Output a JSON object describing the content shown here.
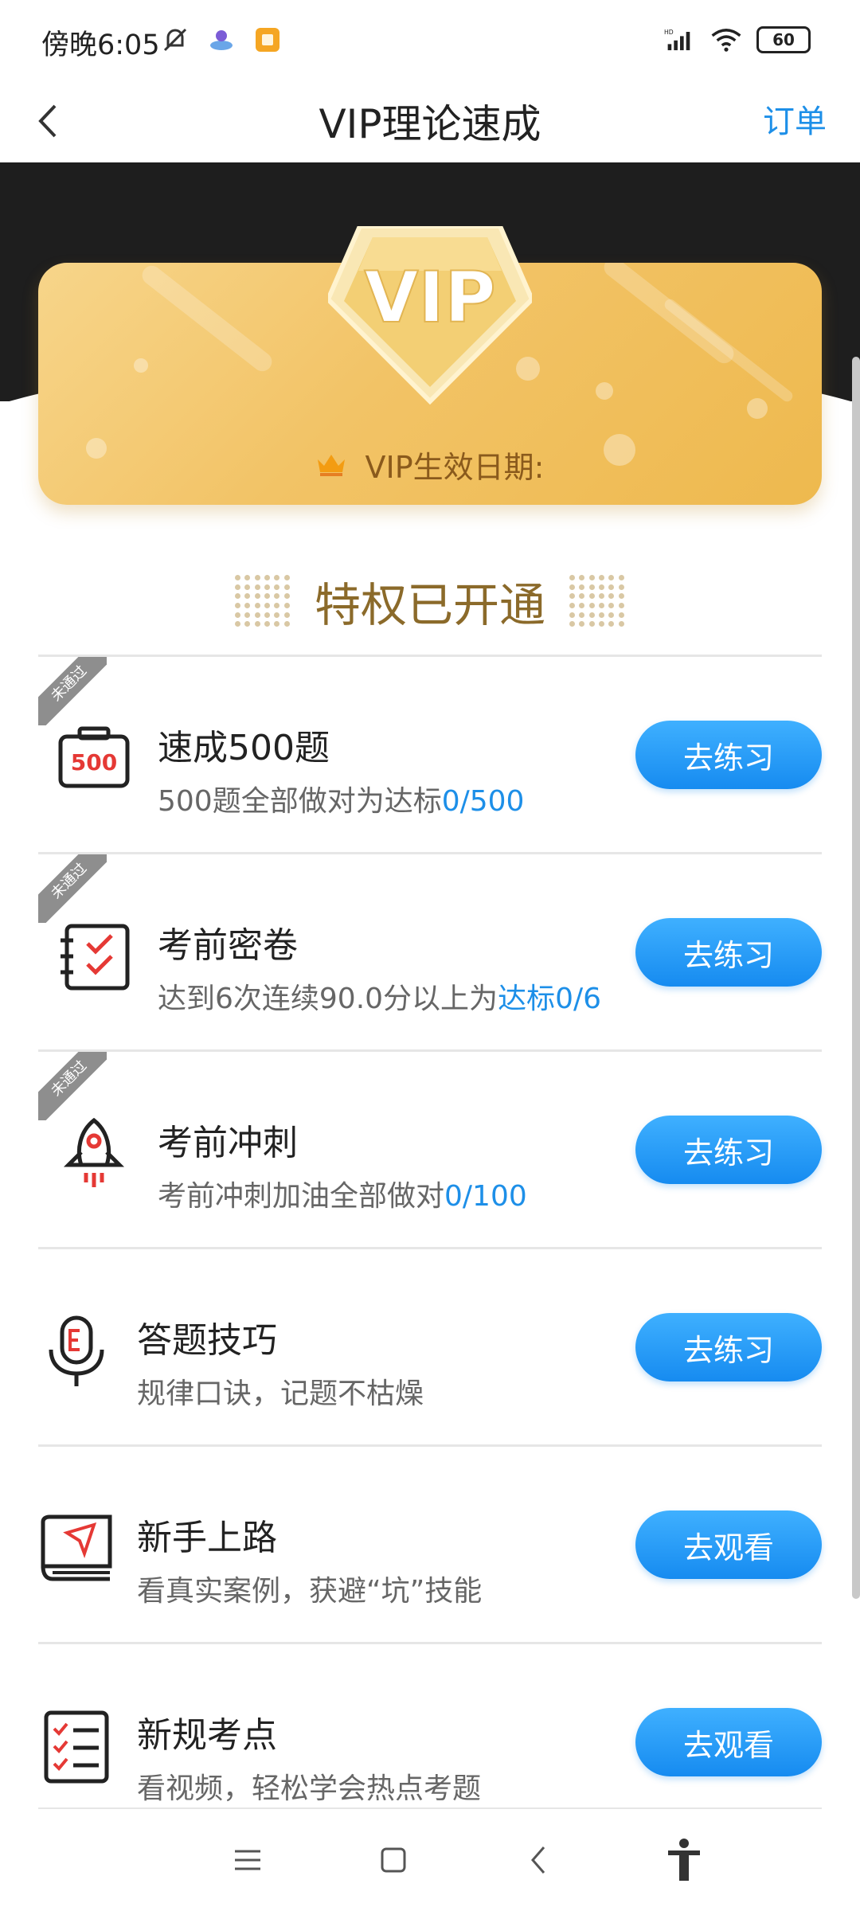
{
  "status_bar": {
    "time": "傍晚6:05",
    "battery": "60"
  },
  "header": {
    "title": "VIP理论速成",
    "orders_label": "订单"
  },
  "vip_card": {
    "badge_text": "VIP",
    "date_label": "VIP生效日期:"
  },
  "section": {
    "title": "特权已开通"
  },
  "items": [
    {
      "title": "速成500题",
      "desc": "500题全部做对为达标",
      "progress": "0/500",
      "button": "去练习",
      "ribbon": "未通过",
      "icon_text": "500"
    },
    {
      "title": "考前密卷",
      "desc": "达到6次连续90.0分以上为",
      "progress": "达标0/6",
      "button": "去练习",
      "ribbon": "未通过"
    },
    {
      "title": "考前冲刺",
      "desc": "考前冲刺加油全部做对",
      "progress": "0/100",
      "button": "去练习",
      "ribbon": "未通过"
    },
    {
      "title": "答题技巧",
      "desc": "规律口诀，记题不枯燥",
      "progress": "",
      "button": "去练习"
    },
    {
      "title": "新手上路",
      "desc": "看真实案例，获避“坑”技能",
      "progress": "",
      "button": "去观看"
    },
    {
      "title": "新规考点",
      "desc": "看视频，轻松学会热点考题",
      "progress": "",
      "button": "去观看"
    }
  ],
  "colors": {
    "accent": "#1d8fe8",
    "gold": "#f2c366",
    "title_gold": "#8b6a2a"
  }
}
